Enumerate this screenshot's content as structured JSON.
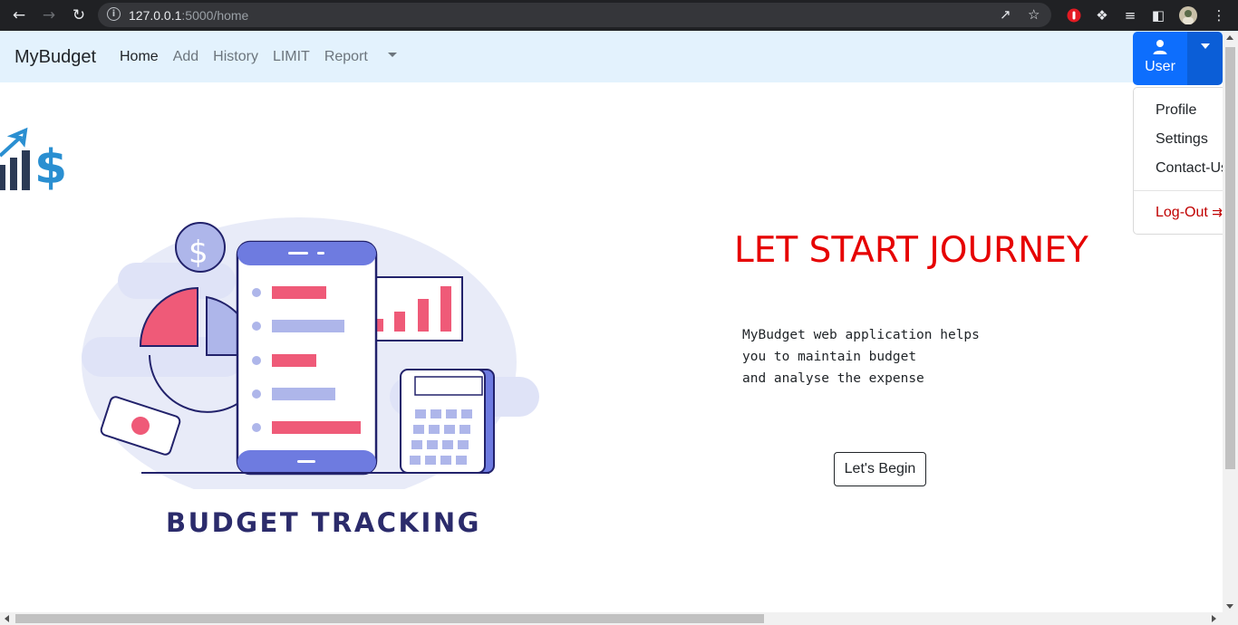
{
  "browser": {
    "url_host": "127.0.0.1",
    "url_rest": ":5000/home",
    "back_icon": "arrow-left-icon",
    "forward_icon": "arrow-right-icon",
    "reload_icon": "reload-icon"
  },
  "navbar": {
    "brand": "MyBudget",
    "links": [
      {
        "label": "Home",
        "active": true
      },
      {
        "label": "Add"
      },
      {
        "label": "History"
      },
      {
        "label": "LIMIT"
      },
      {
        "label": "Report",
        "dropdown": true
      }
    ]
  },
  "user_menu": {
    "button_label": "User",
    "items": [
      "Profile",
      "Settings",
      "Contact-Us"
    ],
    "logout": "Log-Out"
  },
  "hero": {
    "heading": "LET START JOURNEY",
    "description": "MyBudget web application helps\nyou to maintain budget\nand analyse the expense",
    "button": "Let's Begin",
    "illustration_caption": "BUDGET TRACKING"
  },
  "colors": {
    "accent": "#0d6efd",
    "heading_red": "#e60000",
    "navbar_bg": "#e3f2fd",
    "illustration_pink": "#ef5a78",
    "illustration_blue": "#6e7be0"
  }
}
